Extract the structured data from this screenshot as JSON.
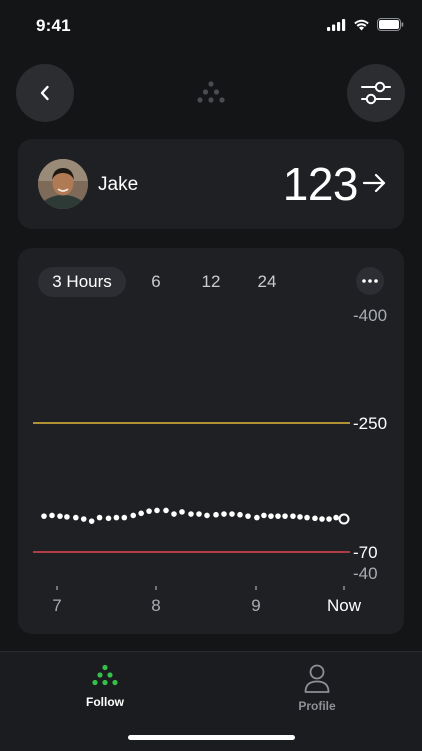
{
  "status_bar": {
    "time": "9:41"
  },
  "user": {
    "name": "Jake",
    "reading": "123"
  },
  "chart_tabs": {
    "items": [
      "3 Hours",
      "6",
      "12",
      "24"
    ],
    "selected": "3 Hours"
  },
  "chart_data": {
    "type": "scatter",
    "title": "",
    "xlabel": "",
    "ylabel": "",
    "x_ticks": [
      "7",
      "8",
      "9",
      "Now"
    ],
    "y_ticks": [
      400,
      250,
      70,
      40
    ],
    "ylim": [
      40,
      400
    ],
    "grid": false,
    "thresholds": [
      {
        "value": 250,
        "color": "#e3b63a"
      },
      {
        "value": 70,
        "color": "#e0474c"
      }
    ],
    "x_range": [
      6.87,
      10.0
    ],
    "series": [
      {
        "x": [
          6.87,
          6.95,
          7.03,
          7.1,
          7.19,
          7.27,
          7.35,
          7.43,
          7.52,
          7.6,
          7.68,
          7.77,
          7.85,
          7.93,
          8.01,
          8.1,
          8.18,
          8.26,
          8.35,
          8.43,
          8.51,
          8.6,
          8.68,
          8.76,
          8.84,
          8.92,
          9.01,
          9.09,
          9.17,
          9.25,
          9.33,
          9.42,
          9.5,
          9.58,
          9.67,
          9.75,
          9.83,
          9.91,
          10.0
        ],
        "values": [
          120,
          121,
          120,
          119,
          118,
          116,
          113,
          118,
          117,
          118,
          118,
          121,
          124,
          127,
          128,
          128,
          123,
          126,
          123,
          123,
          121,
          122,
          123,
          123,
          122,
          120,
          118,
          121,
          120,
          120,
          120,
          120,
          119,
          118,
          117,
          116,
          116,
          118,
          116
        ]
      }
    ]
  },
  "bottom_nav": {
    "follow_label": "Follow",
    "profile_label": "Profile"
  },
  "colors": {
    "accent_green": "#35c04a",
    "high_line": "#e3b63a",
    "low_line": "#e0474c"
  }
}
